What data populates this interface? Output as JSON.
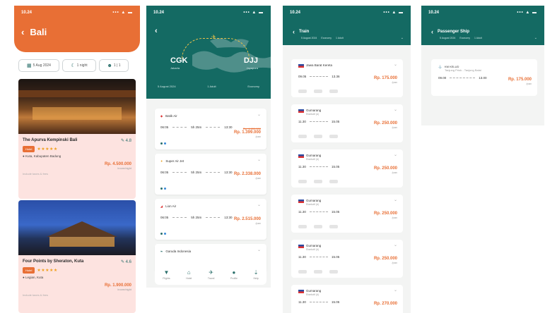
{
  "status": {
    "time": "10.24",
    "signal": "••• ▲ ▬"
  },
  "hotels_screen": {
    "title": "Bali",
    "filters": [
      {
        "icon": "calendar-icon",
        "label": "5 Aug 2024"
      },
      {
        "icon": "moon-icon",
        "label": "1 night"
      },
      {
        "icon": "guests-icon",
        "label": "1 | 1"
      }
    ],
    "hotels": [
      {
        "name": "The Apurva Kempinski Bali",
        "rating": "4.8",
        "tag": "Hotel",
        "stars": "★★★★★",
        "location": "Kuta, Kabupaten Badung",
        "price": "Rp. 4.500.000",
        "price_sub": "/room/night",
        "footer": "Include taxes & fees"
      },
      {
        "name": "Four Points by Sheraton, Kuta",
        "rating": "4.6",
        "tag": "Hotel",
        "stars": "★★★★★",
        "location": "Legian, Kuta",
        "price": "Rp. 1.900.000",
        "price_sub": "/room/night",
        "footer": "Include taxes & fees"
      }
    ]
  },
  "route_screen": {
    "from_code": "CGK",
    "to_code": "DJJ",
    "from_city": "Jakarta",
    "to_city": "Jayapura",
    "meta": [
      "5 August 2024",
      "1 Adult",
      "Economy"
    ],
    "flights": [
      {
        "airline": "Batik Air",
        "dep": "06:05",
        "dur": "5h 25m",
        "arr": "13:30",
        "old_price": "Rp. 1.659.000",
        "price": "Rp. 1.399.000",
        "note": "/pax"
      },
      {
        "airline": "Super Air Jet",
        "dep": "06:05",
        "dur": "5h 25m",
        "arr": "13:30",
        "old_price": "",
        "price": "Rp. 2.338.000",
        "note": "/pax"
      },
      {
        "airline": "Lion Air",
        "dep": "06:05",
        "dur": "5h 25m",
        "arr": "13:30",
        "old_price": "",
        "price": "Rp. 2.515.000",
        "note": "/pax"
      },
      {
        "airline": "Garuda Indonesia",
        "dep": "",
        "dur": "",
        "arr": "",
        "old_price": "",
        "price": "",
        "note": ""
      }
    ],
    "tabs": [
      "Flights",
      "Hotel",
      "Travel",
      "Profile",
      "Help"
    ]
  },
  "train_screen": {
    "title": "Train",
    "subtitle": [
      "5 August 2024",
      "Economy",
      "1 Adult"
    ],
    "trips": [
      {
        "name": "Jawa Barat Kereta",
        "cls": "",
        "dep": "09.05",
        "arr": "13.36",
        "price": "Rp. 175.000",
        "sub": "/pax"
      },
      {
        "name": "Gumarang",
        "cls": "Eksekutif (A)",
        "dep": "11.30",
        "arr": "15.05",
        "price": "Rp. 250.000",
        "sub": "/pax"
      },
      {
        "name": "Gumarang",
        "cls": "Eksekutif (A)",
        "dep": "11.30",
        "arr": "15.05",
        "price": "Rp. 250.000",
        "sub": "/pax"
      },
      {
        "name": "Gumarang",
        "cls": "Eksekutif (A)",
        "dep": "11.30",
        "arr": "15.05",
        "price": "Rp. 250.000",
        "sub": "/pax"
      },
      {
        "name": "Gumarang",
        "cls": "Eksekutif (A)",
        "dep": "11.30",
        "arr": "15.05",
        "price": "Rp. 250.000",
        "sub": "/pax"
      },
      {
        "name": "Gumarang",
        "cls": "Eksekutif (A)",
        "dep": "11.30",
        "arr": "15.05",
        "price": "Rp. 270.000",
        "sub": "/pax"
      }
    ]
  },
  "ship_screen": {
    "title": "Passenger Ship",
    "subtitle": [
      "5 August 2024",
      "Economy",
      "1 Adult"
    ],
    "trip": {
      "name": "KM KELUD",
      "route": "Tanjung Priok - Tanjung Balai",
      "dep": "09.00",
      "arr": "13.00",
      "price": "Rp. 175.000",
      "sub": "/pax"
    }
  }
}
